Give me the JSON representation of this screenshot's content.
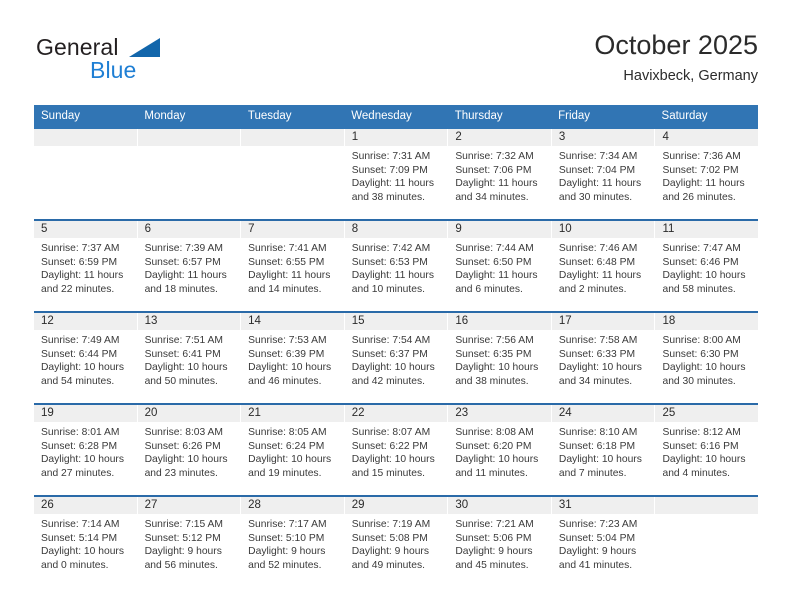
{
  "brand": {
    "word_top": "General",
    "word_bottom": "Blue",
    "triangle_color": "#1266ab",
    "blue_color": "#1f7fd4"
  },
  "header": {
    "title": "October 2025",
    "subtitle": "Havixbeck, Germany"
  },
  "theme": {
    "header_row_bg": "#3175b4",
    "row_divider": "#2a6aa8",
    "day_band_bg": "#efefef"
  },
  "weekdays": [
    "Sunday",
    "Monday",
    "Tuesday",
    "Wednesday",
    "Thursday",
    "Friday",
    "Saturday"
  ],
  "weeks": [
    [
      {
        "day": "",
        "sunrise": "",
        "sunset": "",
        "daylight1": "",
        "daylight2": ""
      },
      {
        "day": "",
        "sunrise": "",
        "sunset": "",
        "daylight1": "",
        "daylight2": ""
      },
      {
        "day": "",
        "sunrise": "",
        "sunset": "",
        "daylight1": "",
        "daylight2": ""
      },
      {
        "day": "1",
        "sunrise": "Sunrise: 7:31 AM",
        "sunset": "Sunset: 7:09 PM",
        "daylight1": "Daylight: 11 hours",
        "daylight2": "and 38 minutes."
      },
      {
        "day": "2",
        "sunrise": "Sunrise: 7:32 AM",
        "sunset": "Sunset: 7:06 PM",
        "daylight1": "Daylight: 11 hours",
        "daylight2": "and 34 minutes."
      },
      {
        "day": "3",
        "sunrise": "Sunrise: 7:34 AM",
        "sunset": "Sunset: 7:04 PM",
        "daylight1": "Daylight: 11 hours",
        "daylight2": "and 30 minutes."
      },
      {
        "day": "4",
        "sunrise": "Sunrise: 7:36 AM",
        "sunset": "Sunset: 7:02 PM",
        "daylight1": "Daylight: 11 hours",
        "daylight2": "and 26 minutes."
      }
    ],
    [
      {
        "day": "5",
        "sunrise": "Sunrise: 7:37 AM",
        "sunset": "Sunset: 6:59 PM",
        "daylight1": "Daylight: 11 hours",
        "daylight2": "and 22 minutes."
      },
      {
        "day": "6",
        "sunrise": "Sunrise: 7:39 AM",
        "sunset": "Sunset: 6:57 PM",
        "daylight1": "Daylight: 11 hours",
        "daylight2": "and 18 minutes."
      },
      {
        "day": "7",
        "sunrise": "Sunrise: 7:41 AM",
        "sunset": "Sunset: 6:55 PM",
        "daylight1": "Daylight: 11 hours",
        "daylight2": "and 14 minutes."
      },
      {
        "day": "8",
        "sunrise": "Sunrise: 7:42 AM",
        "sunset": "Sunset: 6:53 PM",
        "daylight1": "Daylight: 11 hours",
        "daylight2": "and 10 minutes."
      },
      {
        "day": "9",
        "sunrise": "Sunrise: 7:44 AM",
        "sunset": "Sunset: 6:50 PM",
        "daylight1": "Daylight: 11 hours",
        "daylight2": "and 6 minutes."
      },
      {
        "day": "10",
        "sunrise": "Sunrise: 7:46 AM",
        "sunset": "Sunset: 6:48 PM",
        "daylight1": "Daylight: 11 hours",
        "daylight2": "and 2 minutes."
      },
      {
        "day": "11",
        "sunrise": "Sunrise: 7:47 AM",
        "sunset": "Sunset: 6:46 PM",
        "daylight1": "Daylight: 10 hours",
        "daylight2": "and 58 minutes."
      }
    ],
    [
      {
        "day": "12",
        "sunrise": "Sunrise: 7:49 AM",
        "sunset": "Sunset: 6:44 PM",
        "daylight1": "Daylight: 10 hours",
        "daylight2": "and 54 minutes."
      },
      {
        "day": "13",
        "sunrise": "Sunrise: 7:51 AM",
        "sunset": "Sunset: 6:41 PM",
        "daylight1": "Daylight: 10 hours",
        "daylight2": "and 50 minutes."
      },
      {
        "day": "14",
        "sunrise": "Sunrise: 7:53 AM",
        "sunset": "Sunset: 6:39 PM",
        "daylight1": "Daylight: 10 hours",
        "daylight2": "and 46 minutes."
      },
      {
        "day": "15",
        "sunrise": "Sunrise: 7:54 AM",
        "sunset": "Sunset: 6:37 PM",
        "daylight1": "Daylight: 10 hours",
        "daylight2": "and 42 minutes."
      },
      {
        "day": "16",
        "sunrise": "Sunrise: 7:56 AM",
        "sunset": "Sunset: 6:35 PM",
        "daylight1": "Daylight: 10 hours",
        "daylight2": "and 38 minutes."
      },
      {
        "day": "17",
        "sunrise": "Sunrise: 7:58 AM",
        "sunset": "Sunset: 6:33 PM",
        "daylight1": "Daylight: 10 hours",
        "daylight2": "and 34 minutes."
      },
      {
        "day": "18",
        "sunrise": "Sunrise: 8:00 AM",
        "sunset": "Sunset: 6:30 PM",
        "daylight1": "Daylight: 10 hours",
        "daylight2": "and 30 minutes."
      }
    ],
    [
      {
        "day": "19",
        "sunrise": "Sunrise: 8:01 AM",
        "sunset": "Sunset: 6:28 PM",
        "daylight1": "Daylight: 10 hours",
        "daylight2": "and 27 minutes."
      },
      {
        "day": "20",
        "sunrise": "Sunrise: 8:03 AM",
        "sunset": "Sunset: 6:26 PM",
        "daylight1": "Daylight: 10 hours",
        "daylight2": "and 23 minutes."
      },
      {
        "day": "21",
        "sunrise": "Sunrise: 8:05 AM",
        "sunset": "Sunset: 6:24 PM",
        "daylight1": "Daylight: 10 hours",
        "daylight2": "and 19 minutes."
      },
      {
        "day": "22",
        "sunrise": "Sunrise: 8:07 AM",
        "sunset": "Sunset: 6:22 PM",
        "daylight1": "Daylight: 10 hours",
        "daylight2": "and 15 minutes."
      },
      {
        "day": "23",
        "sunrise": "Sunrise: 8:08 AM",
        "sunset": "Sunset: 6:20 PM",
        "daylight1": "Daylight: 10 hours",
        "daylight2": "and 11 minutes."
      },
      {
        "day": "24",
        "sunrise": "Sunrise: 8:10 AM",
        "sunset": "Sunset: 6:18 PM",
        "daylight1": "Daylight: 10 hours",
        "daylight2": "and 7 minutes."
      },
      {
        "day": "25",
        "sunrise": "Sunrise: 8:12 AM",
        "sunset": "Sunset: 6:16 PM",
        "daylight1": "Daylight: 10 hours",
        "daylight2": "and 4 minutes."
      }
    ],
    [
      {
        "day": "26",
        "sunrise": "Sunrise: 7:14 AM",
        "sunset": "Sunset: 5:14 PM",
        "daylight1": "Daylight: 10 hours",
        "daylight2": "and 0 minutes."
      },
      {
        "day": "27",
        "sunrise": "Sunrise: 7:15 AM",
        "sunset": "Sunset: 5:12 PM",
        "daylight1": "Daylight: 9 hours",
        "daylight2": "and 56 minutes."
      },
      {
        "day": "28",
        "sunrise": "Sunrise: 7:17 AM",
        "sunset": "Sunset: 5:10 PM",
        "daylight1": "Daylight: 9 hours",
        "daylight2": "and 52 minutes."
      },
      {
        "day": "29",
        "sunrise": "Sunrise: 7:19 AM",
        "sunset": "Sunset: 5:08 PM",
        "daylight1": "Daylight: 9 hours",
        "daylight2": "and 49 minutes."
      },
      {
        "day": "30",
        "sunrise": "Sunrise: 7:21 AM",
        "sunset": "Sunset: 5:06 PM",
        "daylight1": "Daylight: 9 hours",
        "daylight2": "and 45 minutes."
      },
      {
        "day": "31",
        "sunrise": "Sunrise: 7:23 AM",
        "sunset": "Sunset: 5:04 PM",
        "daylight1": "Daylight: 9 hours",
        "daylight2": "and 41 minutes."
      },
      {
        "day": "",
        "sunrise": "",
        "sunset": "",
        "daylight1": "",
        "daylight2": ""
      }
    ]
  ]
}
